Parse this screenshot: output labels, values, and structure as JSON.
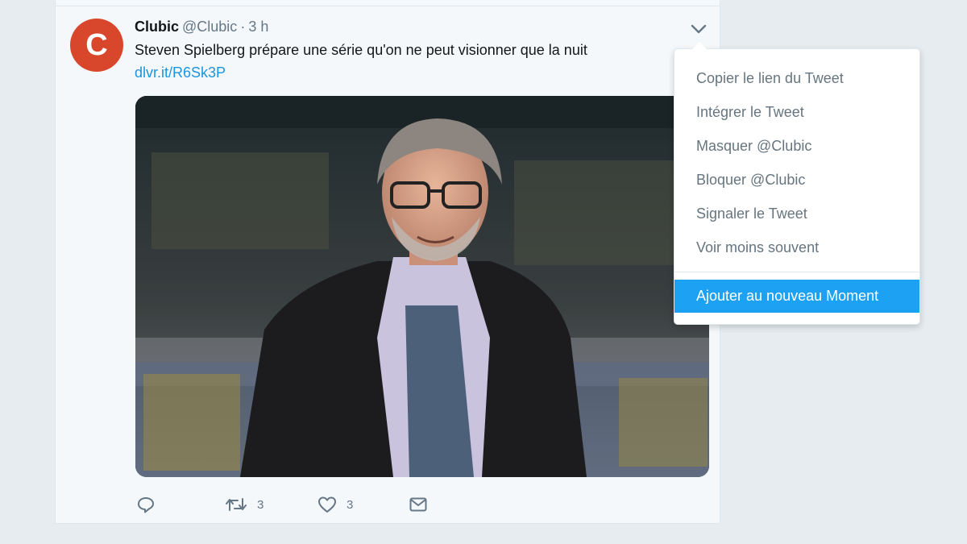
{
  "tweet": {
    "avatar_letter": "C",
    "display_name": "Clubic",
    "handle": "@Clubic",
    "separator": "·",
    "timestamp": "3 h",
    "text": "Steven Spielberg prépare une série qu'on ne peut visionner que la nuit",
    "link": "dlvr.it/R6Sk3P",
    "actions": {
      "reply_icon": "reply-icon",
      "retweet_icon": "retweet-icon",
      "retweet_count": "3",
      "like_icon": "heart-icon",
      "like_count": "3",
      "dm_icon": "envelope-icon"
    }
  },
  "dropdown": {
    "items": [
      {
        "label": "Copier le lien du Tweet"
      },
      {
        "label": "Intégrer le Tweet"
      },
      {
        "label": "Masquer @Clubic"
      },
      {
        "label": "Bloquer @Clubic"
      },
      {
        "label": "Signaler le Tweet"
      },
      {
        "label": "Voir moins souvent"
      }
    ],
    "highlighted_item": {
      "label": "Ajouter au nouveau Moment"
    }
  },
  "colors": {
    "background": "#e6ecf0",
    "timeline": "#f5f8fa",
    "avatar": "#d8472b",
    "link": "#1b95e0",
    "accent": "#1da1f2",
    "muted_text": "#657786"
  }
}
